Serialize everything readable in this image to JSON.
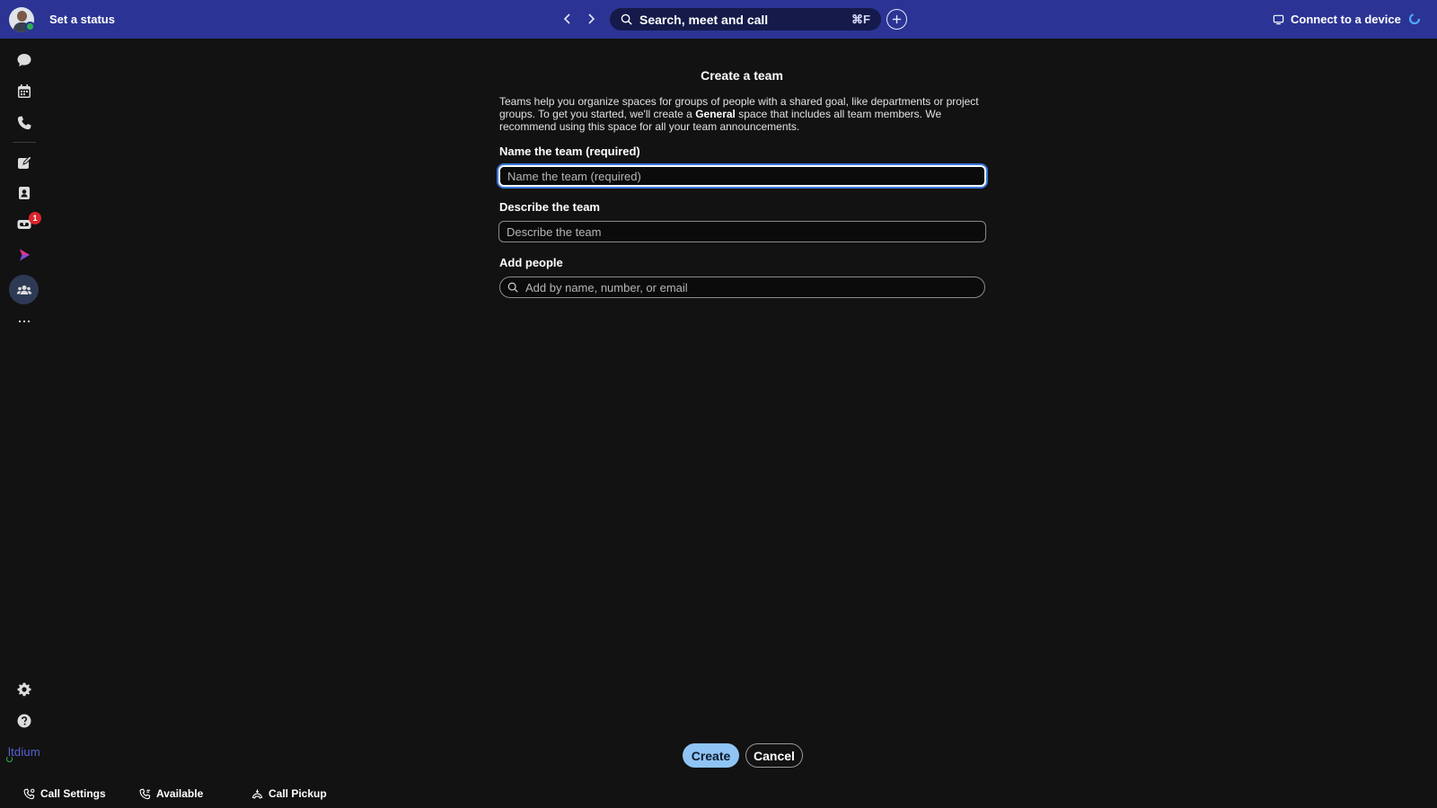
{
  "header": {
    "status_label": "Set a status",
    "search_label": "Search, meet and call",
    "search_shortcut": "⌘F",
    "connect_label": "Connect to a device"
  },
  "rail": {
    "items": [
      {
        "name": "messaging",
        "icon": "chat-bubble-icon"
      },
      {
        "name": "meetings",
        "icon": "calendar-icon"
      },
      {
        "name": "calling",
        "icon": "phone-icon"
      },
      {
        "name": "whiteboards",
        "icon": "whiteboard-pen-icon"
      },
      {
        "name": "contacts",
        "icon": "contacts-icon"
      },
      {
        "name": "voicemail",
        "icon": "voicemail-icon",
        "badge": "1"
      },
      {
        "name": "vidcast",
        "icon": "vidcast-play-icon"
      },
      {
        "name": "teams",
        "icon": "teams-icon",
        "active": true
      },
      {
        "name": "more",
        "icon": "more-dots-icon"
      }
    ],
    "voicemail_badge": "1",
    "settings_icon": "gear-icon",
    "help_icon": "help-icon",
    "brand": "ltdium"
  },
  "form": {
    "title": "Create a team",
    "intro_part1": "Teams help you organize spaces for groups of people with a shared goal, like departments or project groups. To get you started, we'll create a ",
    "intro_bold": "General",
    "intro_part2": " space that includes all team members. We recommend using this space for all your team announcements.",
    "name_label": "Name the team (required)",
    "name_placeholder": "Name the team (required)",
    "name_value": "",
    "describe_label": "Describe the team",
    "describe_placeholder": "Describe the team",
    "describe_value": "",
    "people_label": "Add people",
    "people_placeholder": "Add by name, number, or email",
    "people_value": "",
    "create_label": "Create",
    "cancel_label": "Cancel"
  },
  "footer": {
    "call_settings": "Call Settings",
    "available": "Available",
    "call_pickup": "Call Pickup"
  },
  "colors": {
    "topbar": "#2b3494",
    "background": "#121212",
    "primary_button": "#8fc4f4",
    "badge": "#d9252a",
    "focus_ring": "#3a77d9",
    "presence": "#2bb24c"
  }
}
